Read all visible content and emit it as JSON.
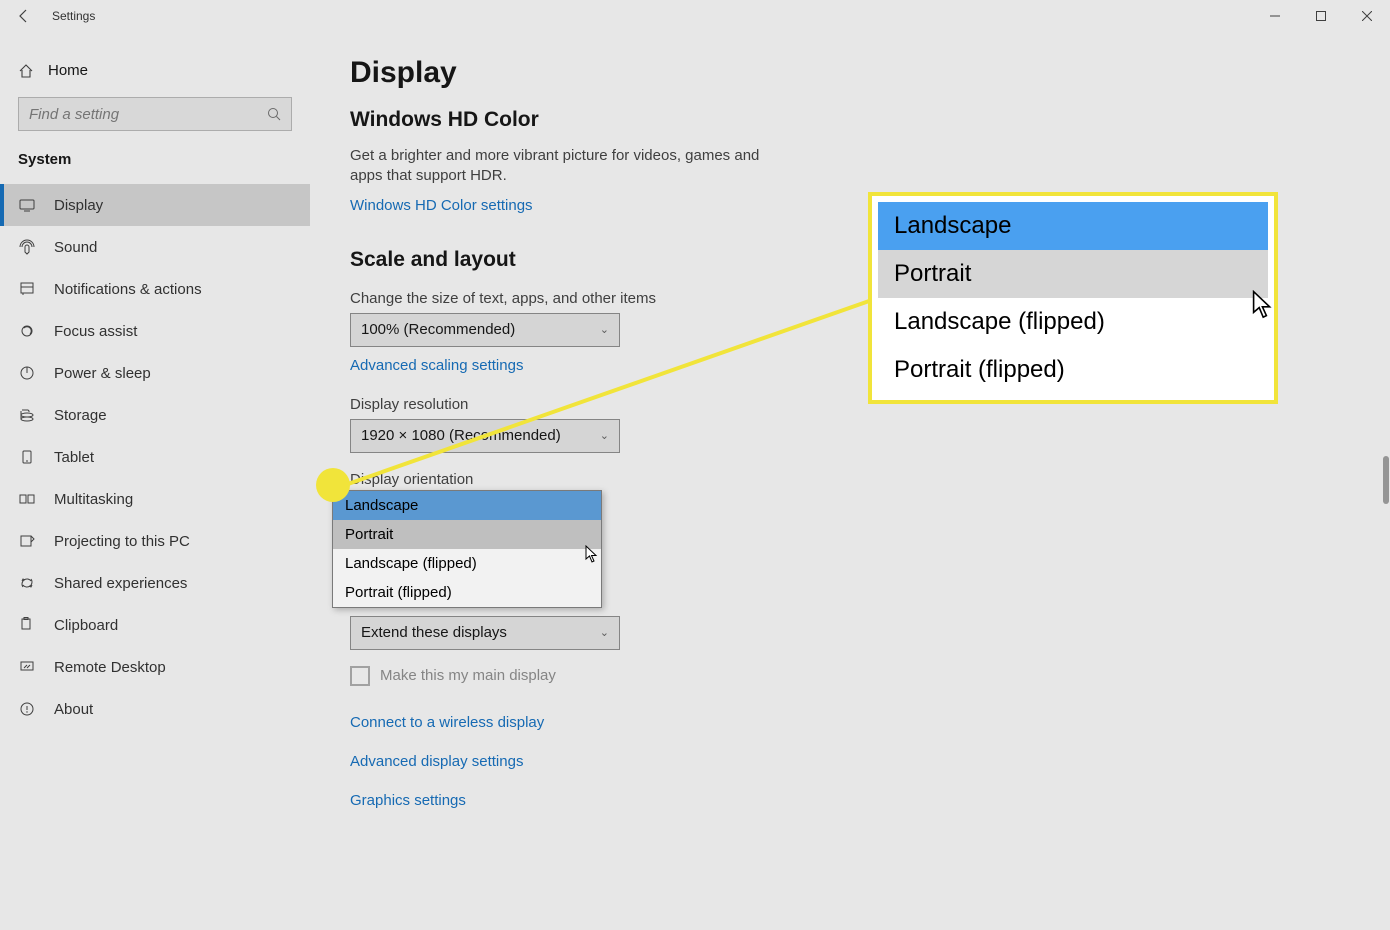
{
  "titlebar": {
    "title": "Settings"
  },
  "sidebar": {
    "home": "Home",
    "search_placeholder": "Find a setting",
    "category": "System",
    "items": [
      "Display",
      "Sound",
      "Notifications & actions",
      "Focus assist",
      "Power & sleep",
      "Storage",
      "Tablet",
      "Multitasking",
      "Projecting to this PC",
      "Shared experiences",
      "Clipboard",
      "Remote Desktop",
      "About"
    ],
    "active_index": 0
  },
  "main": {
    "heading": "Display",
    "hd": {
      "title": "Windows HD Color",
      "desc": "Get a brighter and more vibrant picture for videos, games and apps that support HDR.",
      "link": "Windows HD Color settings"
    },
    "scale": {
      "title": "Scale and layout",
      "scale_label": "Change the size of text, apps, and other items",
      "scale_value": "100% (Recommended)",
      "adv_scaling": "Advanced scaling settings",
      "res_label": "Display resolution",
      "res_value": "1920 × 1080 (Recommended)",
      "orient_label": "Display orientation",
      "orient_options": [
        "Landscape",
        "Portrait",
        "Landscape (flipped)",
        "Portrait (flipped)"
      ],
      "orient_selected_index": 0,
      "orient_hover_index": 1,
      "multi_value": "Extend these displays",
      "main_display_label": "Make this my main display"
    },
    "links": {
      "connect": "Connect to a wireless display",
      "adv_display": "Advanced display settings",
      "graphics": "Graphics settings"
    }
  }
}
